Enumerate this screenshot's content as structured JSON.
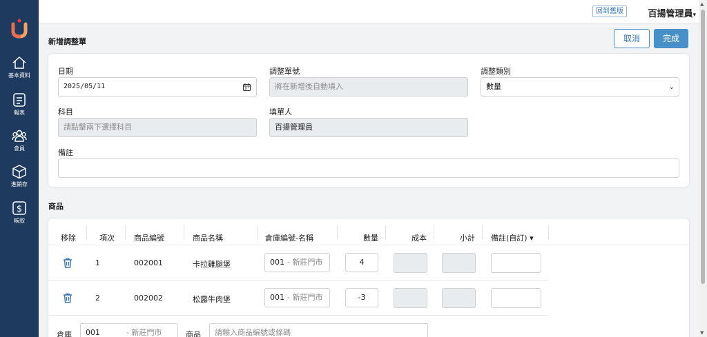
{
  "sidebar": {
    "items": [
      {
        "label": "基本資料",
        "icon": "home-icon"
      },
      {
        "label": "報表",
        "icon": "report-icon"
      },
      {
        "label": "會員",
        "icon": "members-icon"
      },
      {
        "label": "進銷存",
        "icon": "inventory-box-icon"
      },
      {
        "label": "帳款",
        "icon": "dollar-icon"
      }
    ]
  },
  "topbar": {
    "old_version_label": "回到舊版",
    "user_name": "百揚管理員",
    "caret": "▾"
  },
  "page": {
    "title": "新增調整單",
    "cancel_label": "取消",
    "done_label": "完成"
  },
  "form": {
    "date_label": "日期",
    "date_value": "2025/05/11",
    "doc_no_label": "調整單號",
    "doc_no_placeholder": "將在新增後自動填入",
    "adjust_type_label": "調整類別",
    "adjust_type_value": "數量",
    "account_label": "科目",
    "account_placeholder": "請點擊兩下選擇科目",
    "creator_label": "填單人",
    "creator_value": "百揚管理員",
    "note_label": "備註",
    "note_value": ""
  },
  "products": {
    "section_title": "商品",
    "columns": [
      "移除",
      "項次",
      "商品編號",
      "商品名稱",
      "倉庫編號-名稱",
      "數量",
      "成本",
      "小計",
      "備註(自訂) ▾"
    ],
    "rows": [
      {
        "index": "1",
        "code": "002001",
        "name": "卡拉雞腿堡",
        "warehouse_code": "001",
        "warehouse_name": "- 新莊門市",
        "qty": "4",
        "cost": "",
        "subtotal": "",
        "note": ""
      },
      {
        "index": "2",
        "code": "002002",
        "name": "松露牛肉堡",
        "warehouse_code": "001",
        "warehouse_name": "- 新莊門市",
        "qty": "-3",
        "cost": "",
        "subtotal": "",
        "note": ""
      }
    ],
    "add_row": {
      "warehouse_label": "倉庫",
      "warehouse_code": "001",
      "warehouse_name": "- 新莊門市",
      "product_label": "商品",
      "product_placeholder": "請輸入商品編號或條碼"
    }
  },
  "colors": {
    "sidebar_bg": "#1e3a5f",
    "accent": "#4a90c8",
    "readonly_bg": "#e9ecef"
  }
}
